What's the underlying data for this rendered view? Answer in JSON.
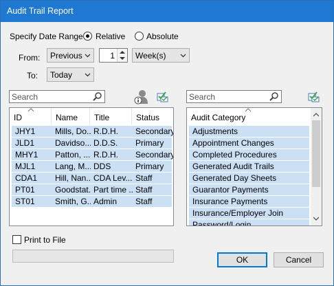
{
  "window": {
    "title": "Audit Trail Report"
  },
  "date_range": {
    "label": "Specify Date Range",
    "relative_label": "Relative",
    "absolute_label": "Absolute",
    "selected": "Relative",
    "from_label": "From:",
    "from_value": "Previous",
    "amount": "1",
    "unit_value": "Week(s)",
    "to_label": "To:",
    "to_value": "Today"
  },
  "users": {
    "search_placeholder": "Search",
    "columns": [
      "ID",
      "Name",
      "Title",
      "Status"
    ],
    "rows": [
      {
        "id": "JHY1",
        "name": "Mills, Do...",
        "title": "R.D.H.",
        "status": "Secondary"
      },
      {
        "id": "JLD1",
        "name": "Davidso...",
        "title": "D.D.S.",
        "status": "Primary"
      },
      {
        "id": "MHY1",
        "name": "Patton, ...",
        "title": "R.D.H.",
        "status": "Secondary"
      },
      {
        "id": "MJL1",
        "name": "Lang, M...",
        "title": "DDS",
        "status": "Primary"
      },
      {
        "id": "CDA1",
        "name": "Hill, Nan...",
        "title": "CDA Lev...",
        "status": "Staff"
      },
      {
        "id": "PT01",
        "name": "Goodstat...",
        "title": "Part time ...",
        "status": "Staff"
      },
      {
        "id": "ST01",
        "name": "Smith, G...",
        "title": "Admin",
        "status": "Staff"
      }
    ]
  },
  "categories": {
    "search_placeholder": "Search",
    "column": "Audit Category",
    "items": [
      "Adjustments",
      "Appointment Changes",
      "Completed Procedures",
      "Generated Audit Trails",
      "Generated Day Sheets",
      "Guarantor Payments",
      "Insurance Payments",
      "Insurance/Employer Join",
      "Password/Login"
    ]
  },
  "print_to_file_label": "Print to File",
  "buttons": {
    "ok": "OK",
    "cancel": "Cancel"
  },
  "icons": {
    "search": "magnifier-icon",
    "user_info": "user-info-icon",
    "select_all": "checklist-icon",
    "dropdown": "chevron-down-icon"
  },
  "colors": {
    "titlebar": "#1f78d1",
    "selection": "#cce0f5",
    "accent": "#0078d7",
    "check_green": "#3aa655"
  }
}
